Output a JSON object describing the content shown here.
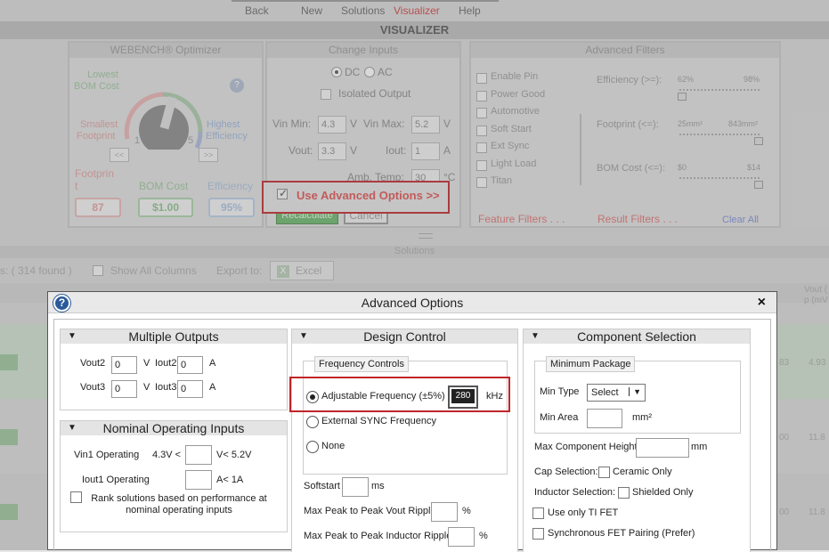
{
  "nav": {
    "back": "Back",
    "new": "New",
    "solutions": "Solutions",
    "visualizer": "Visualizer",
    "help": "Help"
  },
  "page_title": "VISUALIZER",
  "optimizer": {
    "title": "WEBENCH® Optimizer",
    "lowest": "Lowest",
    "bom_cost": "BOM Cost",
    "smallest": "Smallest",
    "footprint": "Footprint",
    "highest": "Highest",
    "efficiency": "Efficiency",
    "dial_1": "1",
    "dial_5": "5",
    "footprint_label": "Footprin",
    "footprint_sub": "t",
    "bom_label": "BOM Cost",
    "eff_label": "Efficiency",
    "footprint_val": "87",
    "bom_val": "$1.00",
    "eff_val": "95%",
    "left_btn": "<<",
    "right_btn": ">>"
  },
  "change_inputs": {
    "title": "Change Inputs",
    "dc": "DC",
    "ac": "AC",
    "isolated": "Isolated Output",
    "vin_min_label": "Vin Min:",
    "vin_min": "4.3",
    "v1": "V",
    "vin_max_label": "Vin Max:",
    "vin_max": "5.2",
    "v2": "V",
    "vout_label": "Vout:",
    "vout": "3.3",
    "v3": "V",
    "iout_label": "Iout:",
    "iout": "1",
    "a1": "A",
    "amb_label": "Amb. Temp:",
    "amb": "30",
    "c_unit": "°C",
    "use_adv": "Use Advanced Options >>",
    "recalc": "Recalculate",
    "cancel": "Cancel"
  },
  "adv_filters": {
    "title": "Advanced Filters",
    "features": [
      "Enable Pin",
      "Power Good",
      "Automotive",
      "Soft Start",
      "Ext Sync",
      "Light Load",
      "Titan"
    ],
    "eff_label": "Efficiency (>=):",
    "eff_min": "62%",
    "eff_max": "98%",
    "foot_label": "Footprint (<=):",
    "foot_min": "25mm²",
    "foot_max": "843mm²",
    "bom_label": "BOM Cost (<=):",
    "bom_min": "$0",
    "bom_max": "$14",
    "feature_filters": "Feature Filters . . .",
    "result_filters": "Result Filters . . .",
    "clear_all": "Clear All"
  },
  "solutions": {
    "bar": "Solutions",
    "found": "s: ( 314 found )",
    "show_all": "Show All Columns",
    "export": "Export to:",
    "excel": "Excel",
    "col_vout": "Vout (",
    "col_vout2": "p (mV",
    "right_vals": [
      "4.93",
      "11.8",
      "11.8"
    ],
    "right_vals2": [
      "83",
      "00",
      "00"
    ]
  },
  "dialog": {
    "title": "Advanced Options",
    "help": "?",
    "close": "×",
    "multiple_outputs": {
      "title": "Multiple Outputs",
      "vout2": "Vout2",
      "vout2_val": "0",
      "v": "V",
      "iout2": "Iout2",
      "iout2_val": "0",
      "a": "A",
      "vout3": "Vout3",
      "vout3_val": "0",
      "iout3": "Iout3",
      "iout3_val": "0"
    },
    "nominal": {
      "title": "Nominal Operating Inputs",
      "vin1": "Vin1 Operating",
      "vin1_pre": "4.3V <",
      "vin1_post": "V< 5.2V",
      "iout1": "Iout1 Operating",
      "iout1_post": "A< 1A",
      "rank": "Rank solutions based on performance at nominal operating inputs"
    },
    "design_control": {
      "title": "Design Control",
      "freq_controls": "Frequency Controls",
      "adjustable": "Adjustable Frequency (±5%)",
      "freq_val": "280",
      "khz": "kHz",
      "ext_sync": "External SYNC Frequency",
      "none": "None",
      "softstart": "Softstart",
      "ms": "ms",
      "vout_ripple": "Max Peak to Peak Vout Ripple",
      "pct1": "%",
      "ind_ripple": "Max Peak to Peak Inductor Ripple",
      "pct2": "%"
    },
    "component_selection": {
      "title": "Component Selection",
      "min_package": "Minimum Package",
      "min_type": "Min Type",
      "select": "Select",
      "min_area": "Min Area",
      "mm2": "mm²",
      "max_height": "Max Component Height",
      "mm": "mm",
      "cap_sel": "Cap Selection:",
      "ceramic": "Ceramic Only",
      "ind_sel": "Inductor Selection:",
      "shielded": "Shielded Only",
      "ti_fet": "Use only TI FET",
      "sync_fet": "Synchronous FET Pairing (Prefer)"
    }
  },
  "colors": {
    "accent_red": "#c0252a",
    "green": "#3a9a3a",
    "blue_link": "#2244cc",
    "help_blue": "#2a5a9a"
  }
}
